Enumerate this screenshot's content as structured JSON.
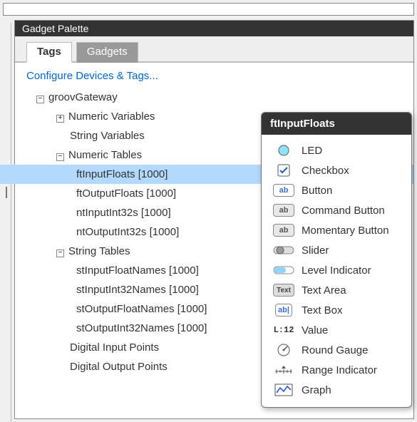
{
  "panel": {
    "title": "Gadget Palette"
  },
  "tabs": {
    "active": "Tags",
    "inactive": "Gadgets"
  },
  "configLink": "Configure Devices & Tags...",
  "tree": {
    "root": "groovGateway",
    "numVars": "Numeric Variables",
    "strVars": "String Variables",
    "numTables": "Numeric Tables",
    "nt0": "ftInputFloats [1000]",
    "nt1": "ftOutputFloats [1000]",
    "nt2": "ntInputInt32s [1000]",
    "nt3": "ntOutputInt32s [1000]",
    "strTables": "String Tables",
    "st0": "stInputFloatNames [1000]",
    "st1": "stInputInt32Names [1000]",
    "st2": "stOutputFloatNames [1000]",
    "st3": "stOutputInt32Names [1000]",
    "dip": "Digital Input Points",
    "dop": "Digital Output Points"
  },
  "popup": {
    "title": "ftInputFloats",
    "items": {
      "led": "LED",
      "checkbox": "Checkbox",
      "button": "Button",
      "cmdButton": "Command Button",
      "momButton": "Momentary Button",
      "slider": "Slider",
      "level": "Level Indicator",
      "textarea": "Text Area",
      "textbox": "Text Box",
      "value": "Value",
      "gauge": "Round Gauge",
      "range": "Range Indicator",
      "graph": "Graph"
    }
  }
}
